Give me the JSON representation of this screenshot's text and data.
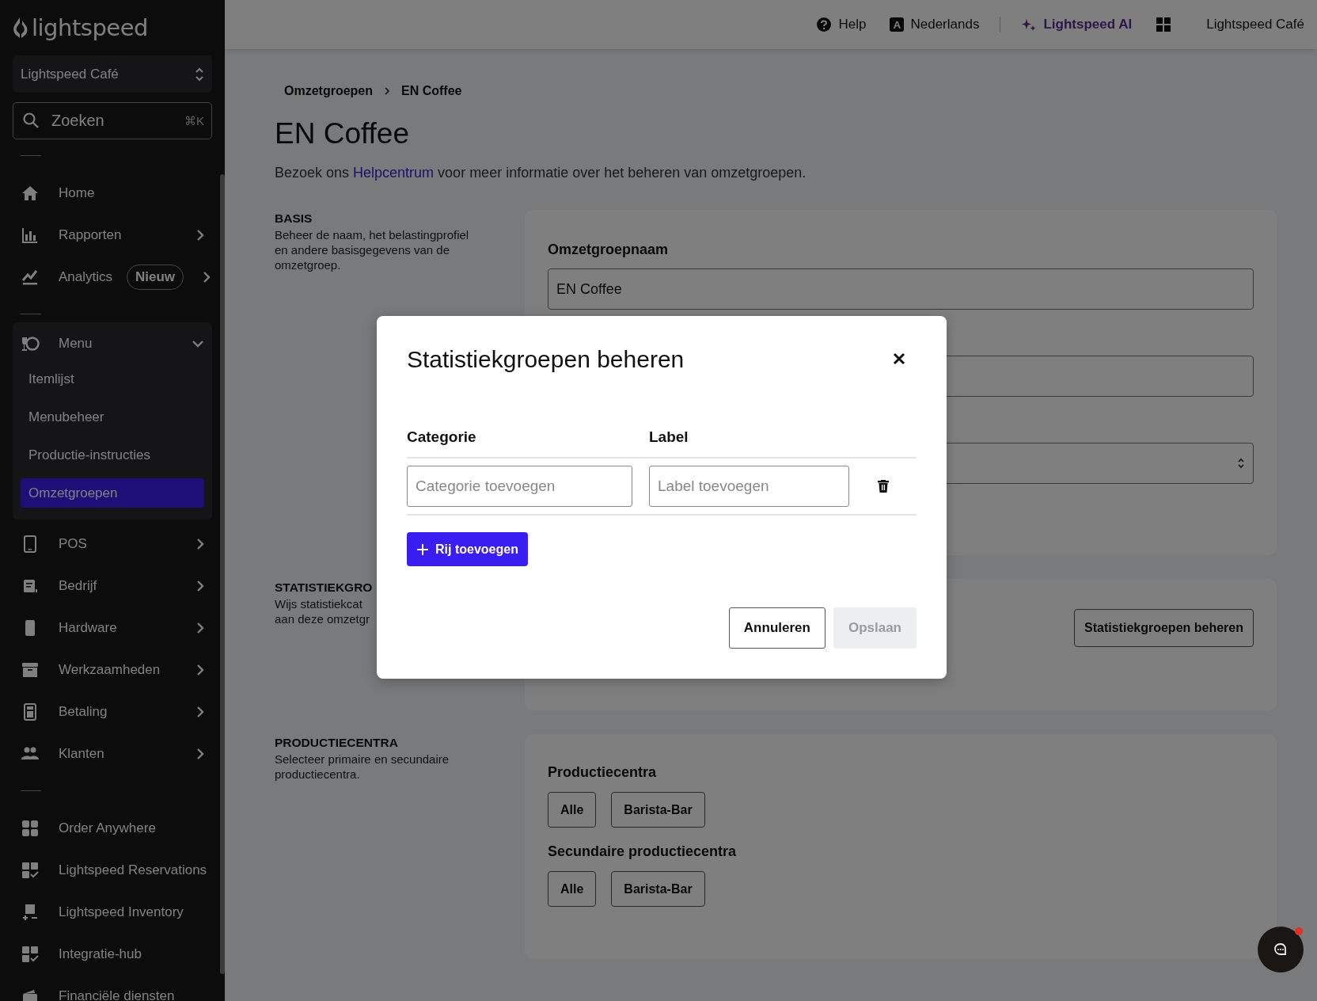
{
  "sidebar": {
    "logo": "lightspeed",
    "location": "Lightspeed Café",
    "search": {
      "placeholder": "Zoeken",
      "shortcut": "⌘K"
    },
    "top_items": [
      {
        "label": "Home",
        "expandable": false
      },
      {
        "label": "Rapporten",
        "expandable": true
      },
      {
        "label": "Analytics",
        "badge": "Nieuw",
        "expandable": true
      }
    ],
    "menu": {
      "label": "Menu",
      "expanded": true,
      "children": [
        {
          "label": "Itemlijst",
          "selected": false
        },
        {
          "label": "Menubeheer",
          "selected": false
        },
        {
          "label": "Productie-instructies",
          "selected": false
        },
        {
          "label": "Omzetgroepen",
          "selected": true
        }
      ]
    },
    "middle_items": [
      {
        "label": "POS",
        "expandable": true
      },
      {
        "label": "Bedrijf",
        "expandable": true
      },
      {
        "label": "Hardware",
        "expandable": true
      },
      {
        "label": "Werkzaamheden",
        "expandable": true
      },
      {
        "label": "Betaling",
        "expandable": true
      },
      {
        "label": "Klanten",
        "expandable": true
      }
    ],
    "bottom_items": [
      {
        "label": "Order Anywhere"
      },
      {
        "label": "Lightspeed Reservations"
      },
      {
        "label": "Lightspeed Inventory"
      },
      {
        "label": "Integratie-hub"
      },
      {
        "label": "Financiële diensten"
      }
    ]
  },
  "topbar": {
    "items": [
      {
        "kind": "help",
        "label": "Help"
      },
      {
        "kind": "language",
        "icon_letter": "A",
        "label": "Nederlands"
      },
      {
        "kind": "ai",
        "label": "Lightspeed AI"
      },
      {
        "kind": "apps"
      },
      {
        "kind": "account",
        "label": "Lightspeed Café"
      }
    ]
  },
  "breadcrumb": [
    {
      "label": "Omzetgroepen"
    },
    {
      "label": "EN Coffee"
    }
  ],
  "title": "EN Coffee",
  "intro": {
    "before": "Bezoek ons",
    "link": "Helpcentrum",
    "after": "voor meer informatie over het beheren van omzetgroepen."
  },
  "sections": [
    {
      "kind": "fields",
      "heading": "BASIS",
      "description": [
        "Beheer de naam, het belastingprofiel",
        "en andere basisgegevens van de",
        "omzetgroep."
      ],
      "fields": [
        {
          "kind": "text",
          "label": "Omzetgroepnaam",
          "value": "EN Coffee"
        },
        {
          "kind": "text"
        },
        {
          "kind": "select"
        }
      ]
    },
    {
      "kind": "action",
      "heading": "STATISTIEKGRO",
      "description": [
        "Wijs statistiekcat",
        "aan deze omzetgr"
      ],
      "button": "Statistiekgroepen beheren"
    },
    {
      "kind": "chips",
      "heading": "PRODUCTIECENTRA",
      "description": [
        "Selecteer primaire en secundaire",
        "productiecentra."
      ],
      "groups": [
        {
          "title": "Productiecentra",
          "options": [
            "Alle",
            "Barista-Bar"
          ]
        },
        {
          "title": "Secundaire productiecentra",
          "options": [
            "Alle",
            "Barista-Bar"
          ]
        }
      ]
    }
  ],
  "modal": {
    "title": "Statistiekgroepen beheren",
    "columns": [
      "Categorie",
      "Label"
    ],
    "rows": [
      {
        "category_placeholder": "Categorie toevoegen",
        "label_placeholder": "Label toevoegen"
      }
    ],
    "add_button": "Rij toevoegen",
    "buttons": [
      {
        "label": "Annuleren",
        "disabled": false
      },
      {
        "label": "Opslaan",
        "disabled": true
      }
    ]
  },
  "chat": {
    "unread": true
  }
}
